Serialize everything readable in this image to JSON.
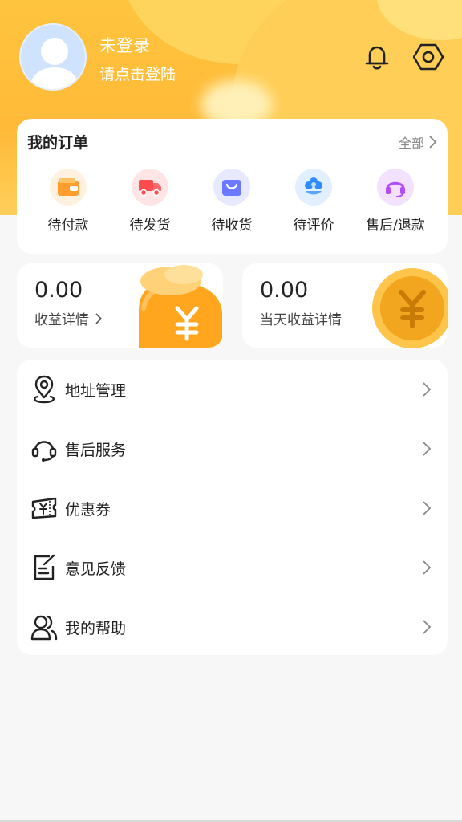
{
  "profile": {
    "username": "未登录",
    "login_hint": "请点击登陆"
  },
  "header_icons": [
    "bell-icon",
    "settings-icon"
  ],
  "orders": {
    "title": "我的订单",
    "all_label": "全部",
    "items": [
      {
        "label": "待付款",
        "icon": "wallet-icon",
        "color": "#ff9d2e"
      },
      {
        "label": "待发货",
        "icon": "truck-icon",
        "color": "#ff4d4f"
      },
      {
        "label": "待收货",
        "icon": "shopping-bag-icon",
        "color": "#5b6cff"
      },
      {
        "label": "待评价",
        "icon": "flower-icon",
        "color": "#2f8cff"
      },
      {
        "label": "售后/退款",
        "icon": "headset-icon",
        "color": "#b14cff"
      }
    ]
  },
  "stats": {
    "income": {
      "value": "0.00",
      "label": "收益详情"
    },
    "today": {
      "value": "0.00",
      "label": "当天收益详情"
    }
  },
  "menu": [
    {
      "label": "地址管理",
      "icon": "location-pin-icon"
    },
    {
      "label": "售后服务",
      "icon": "headset-icon"
    },
    {
      "label": "优惠券",
      "icon": "coupon-icon"
    },
    {
      "label": "意见反馈",
      "icon": "feedback-icon"
    },
    {
      "label": "我的帮助",
      "icon": "users-icon"
    }
  ],
  "colors": {
    "header_yellow": "#ffc43e",
    "coin_orange": "#ffb020"
  }
}
